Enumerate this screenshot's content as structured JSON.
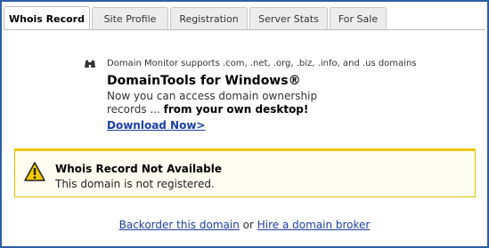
{
  "tabs": [
    {
      "label": "Whois Record",
      "active": true
    },
    {
      "label": "Site Profile",
      "active": false
    },
    {
      "label": "Registration",
      "active": false
    },
    {
      "label": "Server Stats",
      "active": false
    },
    {
      "label": "For Sale",
      "active": false
    }
  ],
  "promo": {
    "icon": "binoculars-icon",
    "note": "Domain Monitor supports .com, .net, .org, .biz, .info, and .us domains",
    "title": "DomainTools for Windows®",
    "body_text": "Now you can access domain ownership records ... ",
    "body_bold": "from your own desktop!",
    "link": "Download Now>"
  },
  "notice": {
    "icon": "warning-icon",
    "title": "Whois Record Not Available",
    "text": "This domain is not registered."
  },
  "actions": {
    "backorder": "Backorder this domain",
    "separator": "or",
    "broker": "Hire a domain broker"
  },
  "colors": {
    "frame": "#2d5fa6",
    "link": "#1b3fa8",
    "notice_border": "#f2c800",
    "notice_bg": "#fffcf0"
  }
}
